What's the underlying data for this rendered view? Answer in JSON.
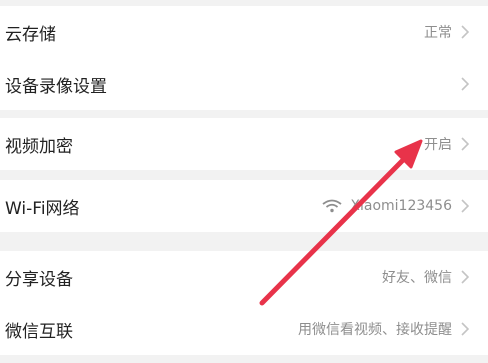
{
  "settings": {
    "cloud_storage": {
      "label": "云存储",
      "value": "正常",
      "icon": "chevron-right-icon"
    },
    "recording": {
      "label": "设备录像设置",
      "icon": "chevron-right-icon"
    },
    "encryption": {
      "label": "视频加密",
      "value": "开启",
      "icon": "chevron-right-icon"
    },
    "wifi": {
      "label": "Wi-Fi网络",
      "value": "Xiaomi123456",
      "icon": "wifi-icon"
    },
    "share": {
      "label": "分享设备",
      "value": "好友、微信",
      "icon": "chevron-right-icon"
    },
    "wechat": {
      "label": "微信互联",
      "value": "用微信看视频、接收提醒",
      "icon": "chevron-right-icon"
    }
  },
  "colors": {
    "background": "#f2f2f2",
    "row": "#ffffff",
    "label": "#222222",
    "value": "#8e8e8e",
    "chevron": "#c4c4c4",
    "arrow": "#e8334a"
  }
}
